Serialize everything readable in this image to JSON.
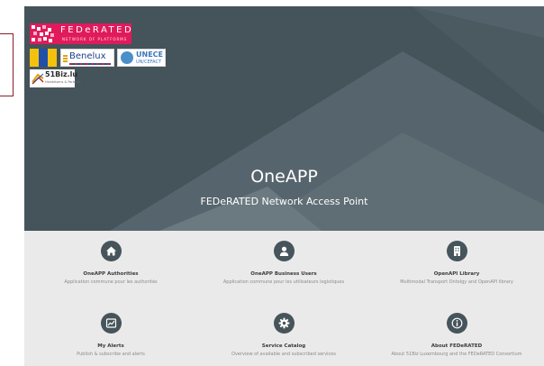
{
  "logos": {
    "federated_name": "FEDeRATED",
    "federated_tagline": "NETWORK OF PLATFORMS",
    "benelux": "Benelux",
    "unece": "UNECE",
    "unece_sub": "UN/CEFACT",
    "biz51": "51Biz.lu",
    "biz51_sub": "Handelsens & Partners"
  },
  "hero": {
    "title": "OneAPP",
    "subtitle": "FEDeRATED Network Access Point"
  },
  "services": [
    {
      "title": "OneAPP Authorities",
      "description": "Application commune pour les authorités",
      "icon": "home-icon"
    },
    {
      "title": "OneAPP Business Users",
      "description": "Application commune pour les utilisateurs logistiques",
      "icon": "user-icon"
    },
    {
      "title": "OpenAPI Library",
      "description": "Multimodal Transport Ontolgy and OpenAPI library",
      "icon": "building-icon"
    },
    {
      "title": "My Alerts",
      "description": "Publish & subscribe and alerts",
      "icon": "chart-icon"
    },
    {
      "title": "Service Catalog",
      "description": "Overview of available and subscribed services",
      "icon": "gear-icon"
    },
    {
      "title": "About FEDeRATED",
      "description": "About 51Biz Luxembourg and the FEDeRATED Consortium",
      "icon": "info-icon"
    }
  ],
  "colors": {
    "hero_bg": "#45535a",
    "services_bg": "#eaeaea",
    "icon_bg": "#46545b",
    "federated_brand": "#e01a5b",
    "frame": "#8b1d2c"
  }
}
